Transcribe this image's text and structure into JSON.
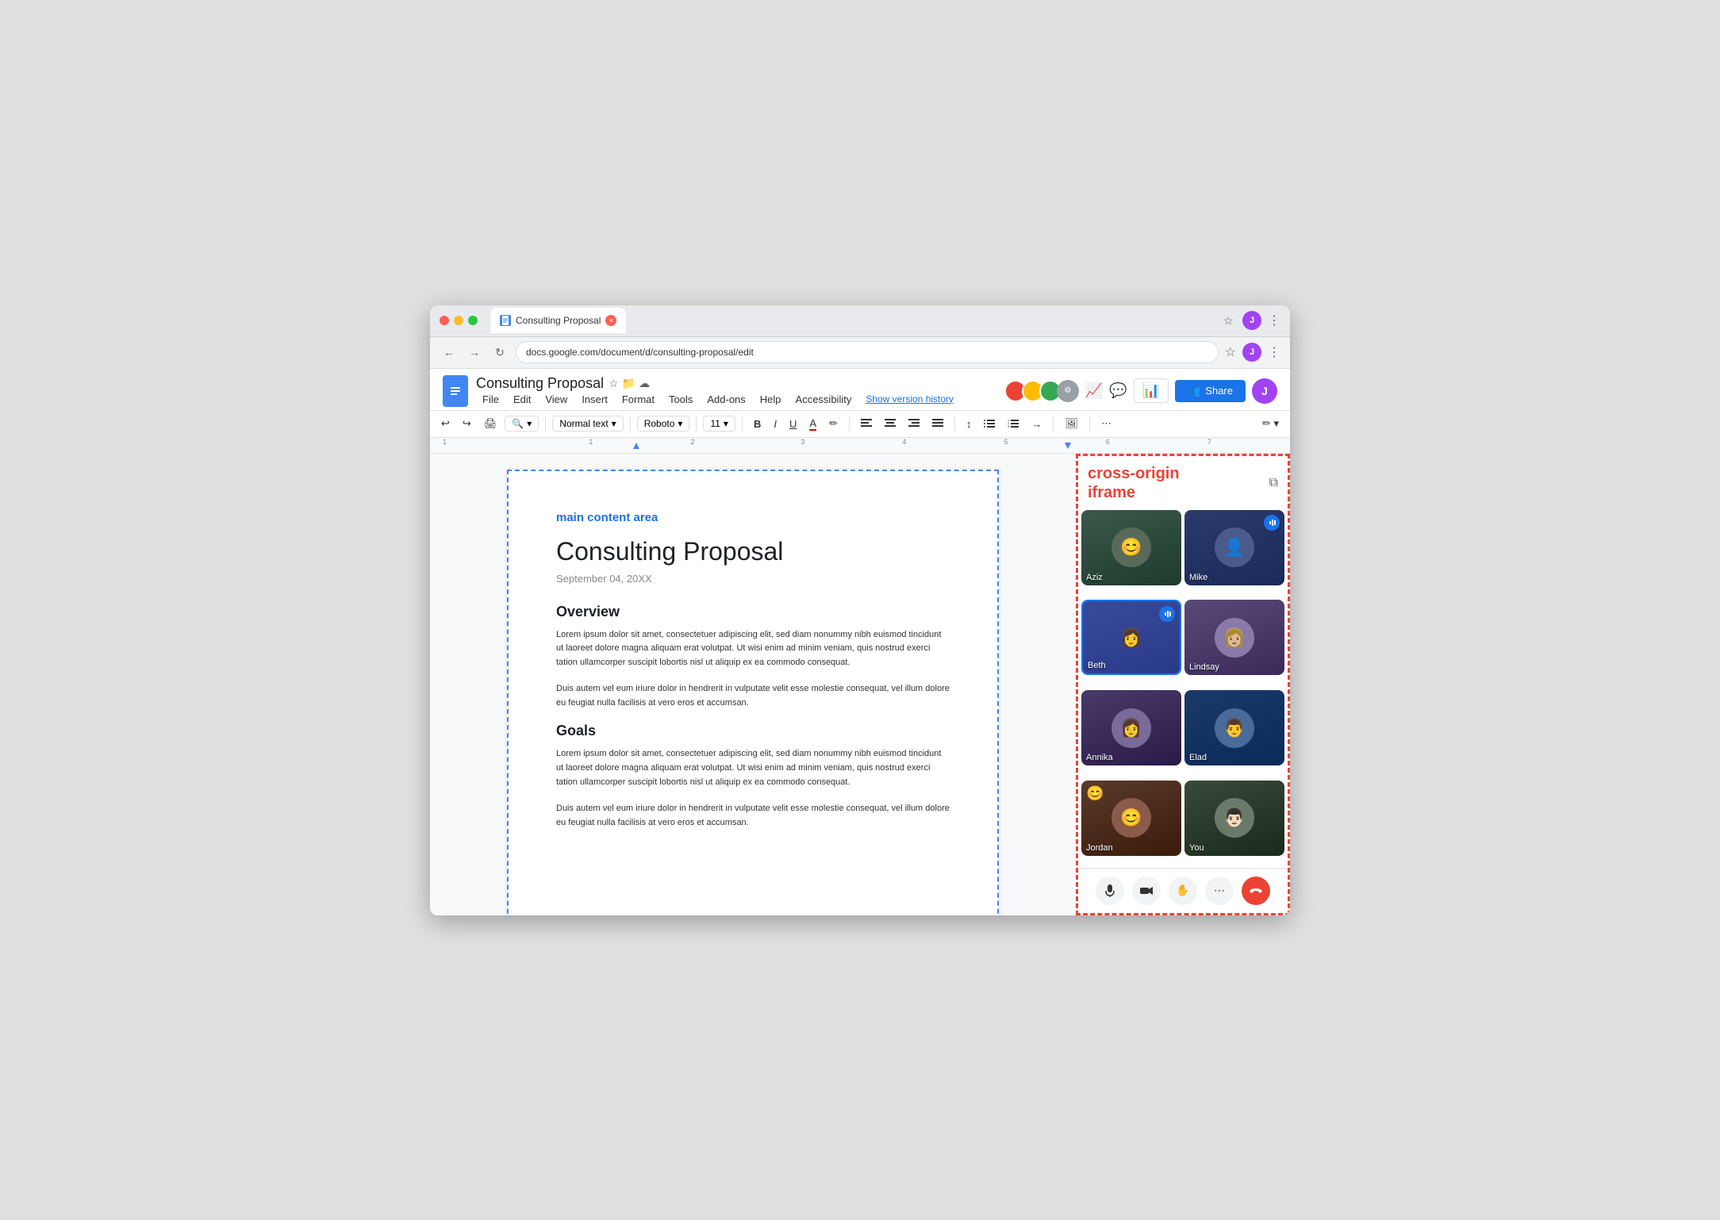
{
  "browser": {
    "tab_title": "Consulting Proposal",
    "tab_close_label": "×",
    "nav_back": "←",
    "nav_forward": "→",
    "nav_refresh": "↻"
  },
  "docs": {
    "logo_icon": "≡",
    "title": "Consulting Proposal",
    "star_icon": "☆",
    "cloud_icon": "☁",
    "folder_icon": "📁",
    "menu": {
      "file": "File",
      "edit": "Edit",
      "view": "View",
      "insert": "Insert",
      "format": "Format",
      "tools": "Tools",
      "addons": "Add-ons",
      "help": "Help",
      "accessibility": "Accessibility"
    },
    "version_history": "Show version history",
    "share_btn": "Share",
    "toolbar": {
      "undo": "↩",
      "redo": "↪",
      "print": "🖨",
      "zoom": "🔍",
      "text_style": "Normal text",
      "font": "Roboto",
      "font_size": "11",
      "bold": "B",
      "italic": "I",
      "underline": "U",
      "text_color": "A",
      "highlight": "✏",
      "align_left": "≡",
      "align_center": "≡",
      "align_right": "≡",
      "justify": "≡",
      "line_spacing": "↕",
      "bullet_list": "☰",
      "numbered_list": "☰",
      "indent": "→",
      "image": "🖼",
      "more": "⋯",
      "edit_pen": "✏"
    }
  },
  "document": {
    "main_area_label": "main content area",
    "title": "Consulting Proposal",
    "date": "September 04, 20XX",
    "section1_title": "Overview",
    "section1_para1": "Lorem ipsum dolor sit amet, consectetuer adipiscing elit, sed diam nonummy nibh euismod tincidunt ut laoreet dolore magna aliquam erat volutpat. Ut wisi enim ad minim veniam, quis nostrud exerci tation ullamcorper suscipit lobortis nisl ut aliquip ex ea commodo consequat.",
    "section1_para2": "Duis autem vel eum iriure dolor in hendrerit in vulputate velit esse molestie consequat, vel illum dolore eu feugiat nulla facilisis at vero eros et accumsan.",
    "section2_title": "Goals",
    "section2_para1": "Lorem ipsum dolor sit amet, consectetuer adipiscing elit, sed diam nonummy nibh euismod tincidunt ut laoreet dolore magna aliquam erat volutpat. Ut wisi enim ad minim veniam, quis nostrud exerci tation ullamcorper suscipit lobortis nisl ut aliquip ex ea commodo consequat.",
    "section2_para2": "Duis autem vel eum iriure dolor in hendrerit in vulputate velit esse molestie consequat, vel illum dolore eu feugiat nulla facilisis at vero eros et accumsan."
  },
  "meet": {
    "cross_origin_label": "cross-origin\niframe",
    "expand_icon": "⧉",
    "participants": [
      {
        "id": "aziz",
        "name": "Aziz",
        "speaking": false,
        "emoji": "",
        "bg": "bg-aziz",
        "face": "👨"
      },
      {
        "id": "mike",
        "name": "Mike",
        "speaking": true,
        "emoji": "",
        "bg": "bg-mike",
        "face": "👨🏿"
      },
      {
        "id": "beth",
        "name": "Beth",
        "speaking": true,
        "emoji": "",
        "bg": "bg-beth",
        "face": "👩"
      },
      {
        "id": "lindsay",
        "name": "Lindsay",
        "speaking": false,
        "emoji": "",
        "bg": "bg-lindsay",
        "face": "👩🏼"
      },
      {
        "id": "annika",
        "name": "Annika",
        "speaking": false,
        "emoji": "",
        "bg": "bg-annika",
        "face": "👩"
      },
      {
        "id": "elad",
        "name": "Elad",
        "speaking": false,
        "emoji": "",
        "bg": "bg-elad",
        "face": "👨"
      },
      {
        "id": "jordan",
        "name": "Jordan",
        "speaking": false,
        "emoji": "😊",
        "bg": "bg-jordan",
        "face": "👨🏽"
      },
      {
        "id": "you",
        "name": "You",
        "speaking": false,
        "emoji": "",
        "bg": "bg-you",
        "face": "👨🏻"
      }
    ],
    "controls": {
      "mic": "🎙",
      "camera": "📷",
      "hand": "✋",
      "more": "⋯",
      "end_call": "📞"
    }
  }
}
